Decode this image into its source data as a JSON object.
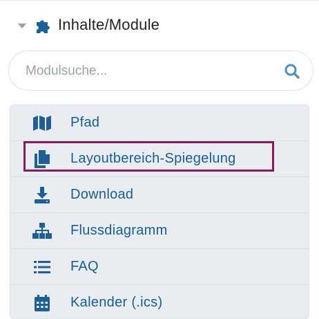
{
  "header": {
    "title": "Inhalte/Module",
    "icon": "puzzle-icon",
    "expand_icon": "caret-down-icon"
  },
  "search": {
    "placeholder": "Modulsuche...",
    "value": "",
    "icon": "search-icon"
  },
  "colors": {
    "accent": "#155f96",
    "icon": "#1f5f98",
    "list_bg": "#e9edf1",
    "highlight_border": "#8c1a5a"
  },
  "modules": [
    {
      "label": "Pfad",
      "icon": "map-icon"
    },
    {
      "label": "Layoutbereich-Spiegelung",
      "icon": "copy-icon",
      "highlighted": true
    },
    {
      "label": "Download",
      "icon": "download-icon"
    },
    {
      "label": "Flussdiagramm",
      "icon": "sitemap-icon"
    },
    {
      "label": "FAQ",
      "icon": "list-icon"
    },
    {
      "label": "Kalender (.ics)",
      "icon": "calendar-icon"
    }
  ]
}
